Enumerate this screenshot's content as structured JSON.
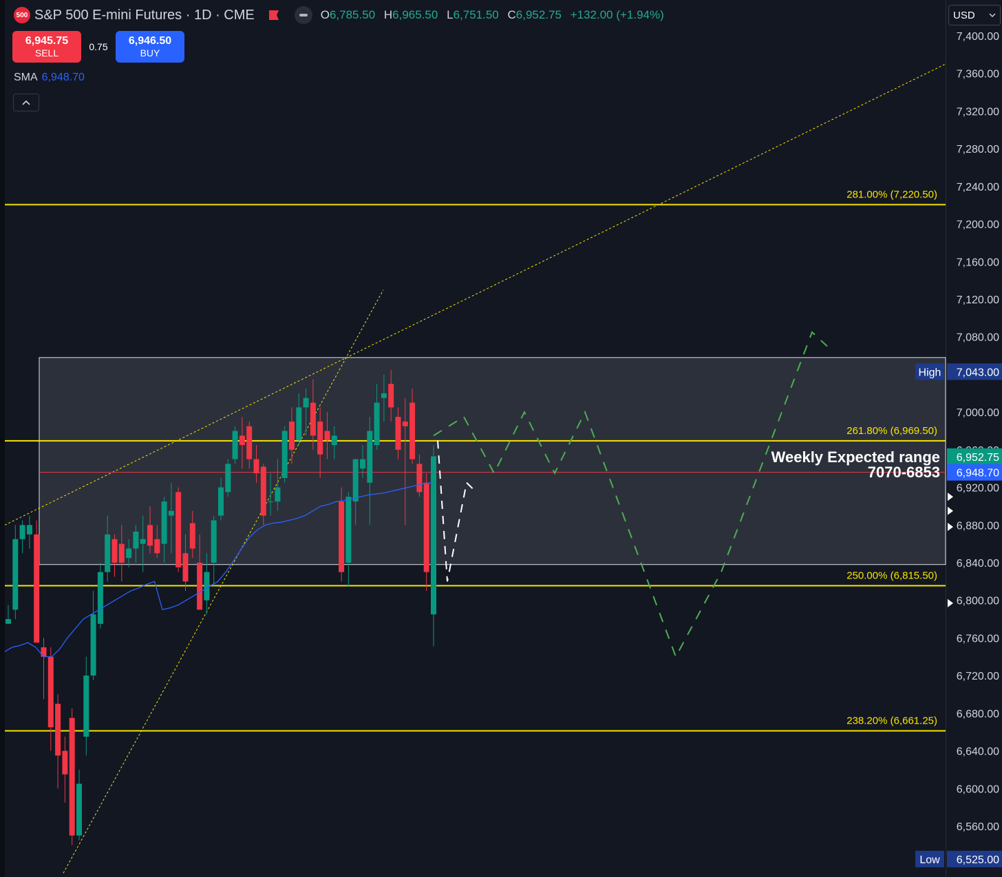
{
  "header": {
    "logo_text": "500",
    "symbol_title": "S&P 500 E-mini Futures · 1D · CME",
    "ohlc": [
      {
        "k": "O",
        "v": "6,785.50"
      },
      {
        "k": "H",
        "v": "6,965.50"
      },
      {
        "k": "L",
        "v": "6,751.50"
      },
      {
        "k": "C",
        "v": "6,952.75"
      }
    ],
    "change": "+132.00 (+1.94%)"
  },
  "trade": {
    "sell_price": "6,945.75",
    "sell_label": "SELL",
    "spread": "0.75",
    "buy_price": "6,946.50",
    "buy_label": "BUY"
  },
  "indicator": {
    "name": "SMA",
    "value": "6,948.70"
  },
  "currency": "USD",
  "colors": {
    "bg": "#131722",
    "up": "#089981",
    "down": "#f23645",
    "fib": "#f7e600",
    "sma": "#2962ff",
    "projection": "#4caf50",
    "path_white": "#ffffff"
  },
  "chart_data": {
    "type": "candlestick",
    "ylim": [
      6510,
      7425
    ],
    "y_ticks": [
      "7,400.00",
      "7,360.00",
      "7,320.00",
      "7,280.00",
      "7,240.00",
      "7,200.00",
      "7,160.00",
      "7,120.00",
      "7,080.00",
      "7,000.00",
      "6,960.00",
      "6,920.00",
      "6,880.00",
      "6,840.00",
      "6,800.00",
      "6,760.00",
      "6,720.00",
      "6,680.00",
      "6,640.00",
      "6,600.00",
      "6,560.00"
    ],
    "candles": [
      {
        "o": 6775,
        "h": 6795,
        "l": 6780,
        "c": 6780
      },
      {
        "o": 6790,
        "h": 6880,
        "l": 6780,
        "c": 6865
      },
      {
        "o": 6865,
        "h": 6885,
        "l": 6850,
        "c": 6880
      },
      {
        "o": 6870,
        "h": 6890,
        "l": 6855,
        "c": 6880
      },
      {
        "o": 6870,
        "h": 6885,
        "l": 6770,
        "c": 6755
      },
      {
        "o": 6750,
        "h": 6760,
        "l": 6695,
        "c": 6740
      },
      {
        "o": 6740,
        "h": 6750,
        "l": 6640,
        "c": 6665
      },
      {
        "o": 6690,
        "h": 6700,
        "l": 6600,
        "c": 6635
      },
      {
        "o": 6640,
        "h": 6655,
        "l": 6585,
        "c": 6615
      },
      {
        "o": 6675,
        "h": 6685,
        "l": 6540,
        "c": 6550
      },
      {
        "o": 6550,
        "h": 6620,
        "l": 6545,
        "c": 6605
      },
      {
        "o": 6655,
        "h": 6740,
        "l": 6635,
        "c": 6720
      },
      {
        "o": 6720,
        "h": 6810,
        "l": 6715,
        "c": 6785
      },
      {
        "o": 6775,
        "h": 6840,
        "l": 6770,
        "c": 6830
      },
      {
        "o": 6830,
        "h": 6890,
        "l": 6820,
        "c": 6870
      },
      {
        "o": 6865,
        "h": 6870,
        "l": 6825,
        "c": 6840
      },
      {
        "o": 6860,
        "h": 6880,
        "l": 6820,
        "c": 6840
      },
      {
        "o": 6845,
        "h": 6865,
        "l": 6835,
        "c": 6855
      },
      {
        "o": 6855,
        "h": 6880,
        "l": 6840,
        "c": 6873
      },
      {
        "o": 6860,
        "h": 6890,
        "l": 6830,
        "c": 6865
      },
      {
        "o": 6880,
        "h": 6900,
        "l": 6850,
        "c": 6858
      },
      {
        "o": 6865,
        "h": 6880,
        "l": 6845,
        "c": 6850
      },
      {
        "o": 6860,
        "h": 6910,
        "l": 6840,
        "c": 6905
      },
      {
        "o": 6890,
        "h": 6925,
        "l": 6850,
        "c": 6895
      },
      {
        "o": 6915,
        "h": 6920,
        "l": 6830,
        "c": 6835
      },
      {
        "o": 6850,
        "h": 6870,
        "l": 6810,
        "c": 6820
      },
      {
        "o": 6882,
        "h": 6895,
        "l": 6845,
        "c": 6855
      },
      {
        "o": 6840,
        "h": 6870,
        "l": 6790,
        "c": 6790
      },
      {
        "o": 6800,
        "h": 6850,
        "l": 6785,
        "c": 6830
      },
      {
        "o": 6840,
        "h": 6890,
        "l": 6815,
        "c": 6885
      },
      {
        "o": 6890,
        "h": 6930,
        "l": 6885,
        "c": 6920
      },
      {
        "o": 6915,
        "h": 6950,
        "l": 6910,
        "c": 6945
      },
      {
        "o": 6950,
        "h": 6985,
        "l": 6945,
        "c": 6980
      },
      {
        "o": 6975,
        "h": 6995,
        "l": 6940,
        "c": 6965
      },
      {
        "o": 6985,
        "h": 6990,
        "l": 6940,
        "c": 6950
      },
      {
        "o": 6950,
        "h": 6965,
        "l": 6925,
        "c": 6935
      },
      {
        "o": 6942,
        "h": 6945,
        "l": 6880,
        "c": 6890
      },
      {
        "o": 6905,
        "h": 6935,
        "l": 6890,
        "c": 6905
      },
      {
        "o": 6905,
        "h": 6950,
        "l": 6895,
        "c": 6920
      },
      {
        "o": 6930,
        "h": 6985,
        "l": 6925,
        "c": 6980
      },
      {
        "o": 6990,
        "h": 7005,
        "l": 6945,
        "c": 6960
      },
      {
        "o": 6970,
        "h": 7020,
        "l": 6965,
        "c": 7005
      },
      {
        "o": 7005,
        "h": 7025,
        "l": 6975,
        "c": 7015
      },
      {
        "o": 7010,
        "h": 7035,
        "l": 6960,
        "c": 6975
      },
      {
        "o": 6990,
        "h": 7005,
        "l": 6930,
        "c": 6955
      },
      {
        "o": 6980,
        "h": 7000,
        "l": 6950,
        "c": 6970
      },
      {
        "o": 6965,
        "h": 6985,
        "l": 6950,
        "c": 6975
      },
      {
        "o": 6905,
        "h": 6920,
        "l": 6820,
        "c": 6830
      },
      {
        "o": 6840,
        "h": 6915,
        "l": 6815,
        "c": 6910
      },
      {
        "o": 6905,
        "h": 6950,
        "l": 6880,
        "c": 6950
      },
      {
        "o": 6940,
        "h": 6965,
        "l": 6930,
        "c": 6950
      },
      {
        "o": 6925,
        "h": 6995,
        "l": 6880,
        "c": 6980
      },
      {
        "o": 6965,
        "h": 7030,
        "l": 6960,
        "c": 7010
      },
      {
        "o": 7015,
        "h": 7040,
        "l": 6990,
        "c": 7020
      },
      {
        "o": 7030,
        "h": 7045,
        "l": 6990,
        "c": 7005
      },
      {
        "o": 6995,
        "h": 7005,
        "l": 6950,
        "c": 6960
      },
      {
        "o": 6990,
        "h": 7015,
        "l": 6880,
        "c": 6985
      },
      {
        "o": 7010,
        "h": 7025,
        "l": 6945,
        "c": 6950
      },
      {
        "o": 6945,
        "h": 6955,
        "l": 6910,
        "c": 6915
      },
      {
        "o": 6925,
        "h": 6935,
        "l": 6810,
        "c": 6830
      },
      {
        "o": 6785,
        "h": 6965,
        "l": 6751,
        "c": 6953
      }
    ],
    "sma_values": [
      6785,
      6790,
      6792,
      6795,
      6790,
      6780,
      6780,
      6788,
      6800,
      6810,
      6820,
      6825,
      6830,
      6835,
      6840,
      6845,
      6850,
      6853,
      6857,
      6860,
      6860,
      6862,
      6865,
      6870,
      6875,
      6880,
      6885,
      6890,
      6900,
      6912,
      6925,
      6937,
      6945,
      6950,
      6952,
      6953,
      6955,
      6957,
      6960,
      6965,
      6970,
      6972,
      6975,
      6976,
      6978,
      6980,
      6982,
      6983,
      6984,
      6986,
      6988,
      6990,
      6992,
      6994,
      6995
    ],
    "fib_levels": [
      {
        "label": "281.00% (7,220.50)",
        "value": 7220.5
      },
      {
        "label": "261.80% (6,969.50)",
        "value": 6969.5
      },
      {
        "label": "250.00% (6,815.50)",
        "value": 6815.5
      },
      {
        "label": "238.20% (6,661.25)",
        "value": 6661.25
      }
    ],
    "range_box": {
      "high": 7058,
      "low": 6838
    },
    "annotation": {
      "line1": "Weekly Expected range",
      "line2": "7070-6853"
    },
    "price_tags": [
      {
        "text": "High",
        "value": "7,043.00",
        "y": 7043,
        "bg": "#1e3a8a"
      },
      {
        "text": "",
        "value": "6,952.75",
        "y": 6952.75,
        "bg": "#089981"
      },
      {
        "text": "",
        "value": "6,948.70",
        "y": 6936,
        "bg": "#2962ff"
      },
      {
        "text": "Low",
        "value": "6,525.00",
        "y": 6525,
        "bg": "#1e3a8a"
      }
    ],
    "projection_green": [
      [
        0,
        6975
      ],
      [
        2,
        6995
      ],
      [
        4,
        6935
      ],
      [
        6,
        7000
      ],
      [
        8,
        6935
      ],
      [
        10,
        7000
      ],
      [
        16,
        6740
      ],
      [
        19,
        6830
      ],
      [
        25,
        7085
      ],
      [
        26,
        7070
      ]
    ],
    "projection_white": [
      [
        0,
        6970
      ],
      [
        1,
        6820
      ],
      [
        3,
        6925
      ],
      [
        4,
        6915
      ]
    ]
  }
}
